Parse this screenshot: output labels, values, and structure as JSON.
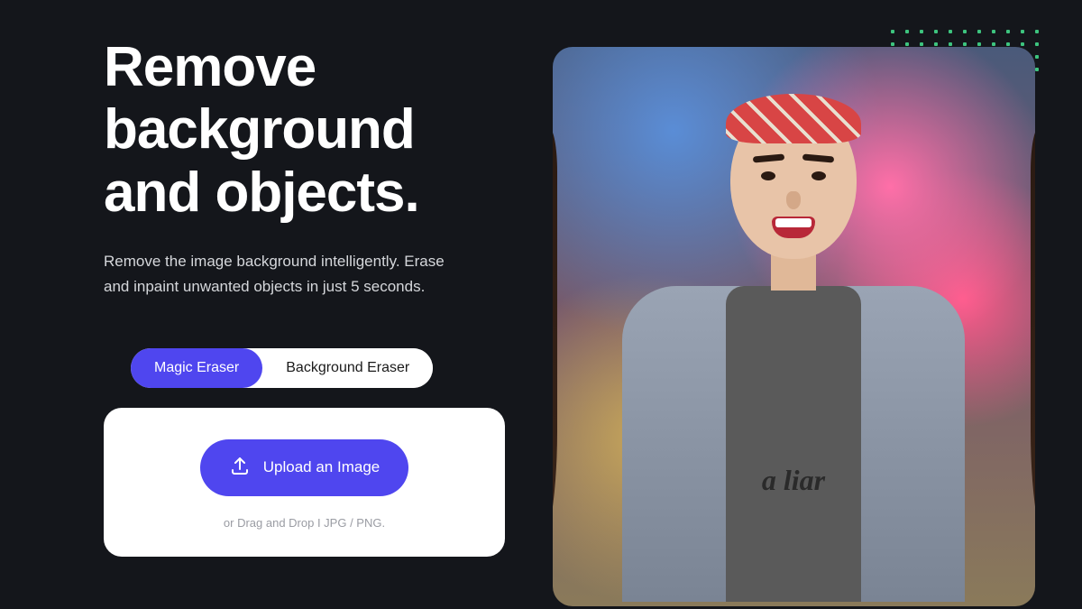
{
  "hero": {
    "headline": "Remove background and objects.",
    "subheadline": "Remove the image background intelligently. Erase and inpaint unwanted objects in just 5 seconds."
  },
  "tabs": {
    "magic_eraser": "Magic Eraser",
    "background_eraser": "Background Eraser"
  },
  "upload": {
    "button_label": "Upload an Image",
    "drop_hint": "or Drag and Drop I JPG / PNG."
  },
  "colors": {
    "accent": "#4f46ef",
    "background": "#14161b",
    "dots": "#3dc47e"
  }
}
